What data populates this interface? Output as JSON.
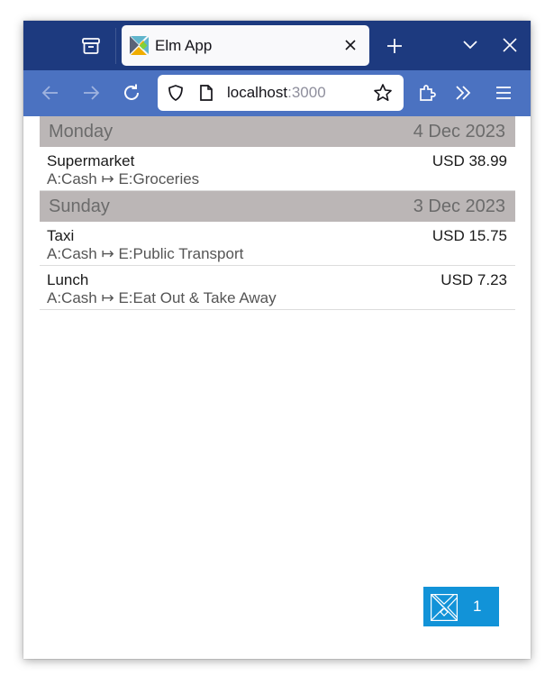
{
  "browser": {
    "tab": {
      "title": "Elm App",
      "favicon": "elm-logo-icon"
    },
    "url": {
      "host": "localhost",
      "port": ":3000"
    },
    "icons": {
      "container": "container-icon",
      "new_tab": "plus-icon",
      "list_tabs": "chevron-down-icon",
      "window_close": "close-icon",
      "back": "arrow-left-icon",
      "forward": "arrow-right-icon",
      "reload": "reload-icon",
      "shield": "shield-icon",
      "page": "page-icon",
      "bookmark": "star-icon",
      "extensions": "puzzle-icon",
      "overflow": "double-chevron-icon",
      "menu": "hamburger-icon"
    },
    "colors": {
      "tabstrip": "#1d3a7f",
      "navbar": "#4b72c1",
      "tab": "#f9f9fb"
    }
  },
  "days": [
    {
      "day": "Monday",
      "date": "4 Dec 2023",
      "transactions": [
        {
          "payee": "Supermarket",
          "amount": "USD 38.99",
          "accounts": "A:Cash ↦ E:Groceries"
        }
      ]
    },
    {
      "day": "Sunday",
      "date": "3 Dec 2023",
      "transactions": [
        {
          "payee": "Taxi",
          "amount": "USD 15.75",
          "accounts": "A:Cash ↦ E:Public Transport"
        },
        {
          "payee": "Lunch",
          "amount": "USD 7.23",
          "accounts": "A:Cash ↦ E:Eat Out & Take Away"
        }
      ]
    }
  ],
  "elm_debugger": {
    "count": "1",
    "color": "#1293d8"
  },
  "theme": {
    "day_header_bg": "#bbb6b6"
  }
}
